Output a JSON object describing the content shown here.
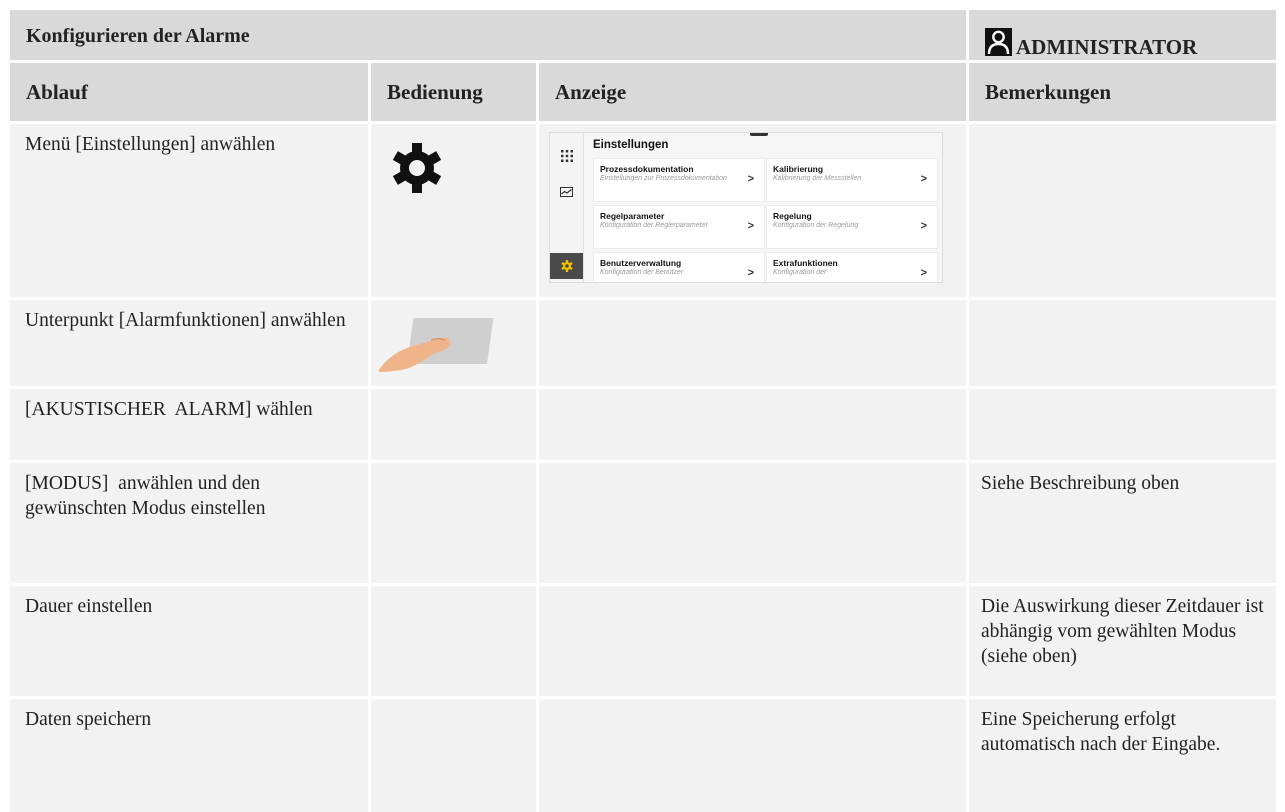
{
  "header": {
    "title": "Konfigurieren der Alarme",
    "role": "ADMINISTRATOR"
  },
  "columns": {
    "ablauf": "Ablauf",
    "bedienung": "Bedienung",
    "anzeige": "Anzeige",
    "bemerkungen": "Bemerkungen"
  },
  "rows": [
    {
      "ablauf": "Menü [Einstellungen] anwählen",
      "bedienung_icon": "gear-icon",
      "bemerkungen": ""
    },
    {
      "ablauf": "Unterpunkt [Alarmfunktionen] anwählen",
      "bedienung_icon": "finger-tap-icon",
      "bemerkungen": ""
    },
    {
      "ablauf": "[AKUSTISCHER  ALARM] wählen",
      "bedienung_icon": "",
      "bemerkungen": ""
    },
    {
      "ablauf": "[MODUS]  anwählen und den gewünschten Modus einstellen",
      "bedienung_icon": "",
      "bemerkungen": "Siehe Beschreibung oben"
    },
    {
      "ablauf": "Dauer einstellen",
      "bedienung_icon": "",
      "bemerkungen": "Die Auswirkung dieser Zeitdauer ist abhängig vom gewählten Modus (siehe oben)"
    },
    {
      "ablauf": "Daten speichern",
      "bedienung_icon": "",
      "bemerkungen": "Eine Speicherung erfolgt automatisch nach der Eingabe."
    }
  ],
  "screen": {
    "heading": "Einstellungen",
    "cards": [
      {
        "title": "Prozessdokumentation",
        "desc": "Einstellungen zur Prozessdokumentation"
      },
      {
        "title": "Kalibrierung",
        "desc": "Kalibrierung der Messstellen"
      },
      {
        "title": "Regelparameter",
        "desc": "Konfiguration der Reglerparameter"
      },
      {
        "title": "Regelung",
        "desc": "Konfiguration der Regelung"
      },
      {
        "title": "Benutzerverwaltung",
        "desc": "Konfiguration der Benutzer"
      },
      {
        "title": "Extrafunktionen",
        "desc": "Konfiguration der"
      }
    ],
    "chevron": ">",
    "sidebar_icons": [
      "grid-icon",
      "chart-icon",
      "gear-icon"
    ]
  },
  "colors": {
    "header_bg": "#d9d9d9",
    "cell_bg": "#f2f2f2",
    "icon_dark": "#111111"
  }
}
